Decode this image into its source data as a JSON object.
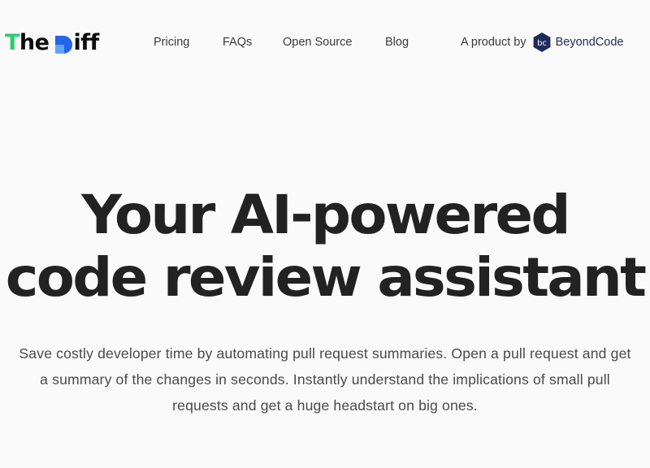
{
  "header": {
    "logo": {
      "letters_t": "T",
      "letters_he": "he",
      "letters_rest": "iff",
      "full_text": "The Diff",
      "colors": {
        "t": "#2ecc71",
        "d_primary": "#2563eb",
        "d_secondary": "#60a5fa",
        "text": "#0c0c0c"
      }
    },
    "nav": [
      {
        "label": "Pricing"
      },
      {
        "label": "FAQs"
      },
      {
        "label": "Open Source"
      },
      {
        "label": "Blog"
      }
    ],
    "product_by": {
      "prefix": "A product by",
      "brand_name": "BeyondCode",
      "brand_icon": "beyondcode-hexagon-icon",
      "brand_icon_text": "bc",
      "brand_color": "#1f2a5c"
    }
  },
  "hero": {
    "title_line_1": "Your AI-powered",
    "title_line_2": "code review assistant",
    "subtitle": "Save costly developer time by automating pull request summaries. Open a pull request and get a summary of the changes in seconds. Instantly understand the implications of small pull requests and get a huge headstart on big ones."
  },
  "theme": {
    "background": "#fafafa",
    "heading_color": "#222222",
    "body_text_color": "#4a4a4a",
    "nav_text_color": "#3a3a3a"
  }
}
